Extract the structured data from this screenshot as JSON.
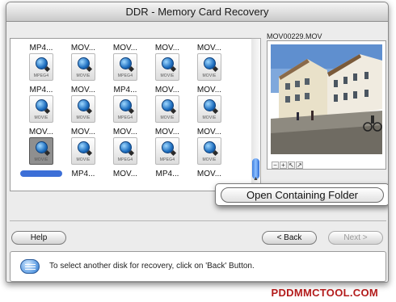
{
  "window": {
    "title": "DDR - Memory Card Recovery"
  },
  "files": [
    {
      "name": "MP4...",
      "tag": "",
      "selected": false
    },
    {
      "name": "MOV...",
      "tag": "",
      "selected": false
    },
    {
      "name": "MOV...",
      "tag": "",
      "selected": false
    },
    {
      "name": "MOV...",
      "tag": "",
      "selected": false
    },
    {
      "name": "MOV...",
      "tag": "",
      "selected": false
    },
    {
      "name": "MP4...",
      "tag": "MPEG4",
      "selected": false
    },
    {
      "name": "MOV...",
      "tag": "MOVIE",
      "selected": false
    },
    {
      "name": "MP4...",
      "tag": "MPEG4",
      "selected": false
    },
    {
      "name": "MOV...",
      "tag": "MOVIE",
      "selected": false
    },
    {
      "name": "MOV...",
      "tag": "MOVIE",
      "selected": false
    },
    {
      "name": "MOV...",
      "tag": "MOVIE",
      "selected": false
    },
    {
      "name": "MOV...",
      "tag": "MOVIE",
      "selected": false
    },
    {
      "name": "MOV...",
      "tag": "MPEG4",
      "selected": false
    },
    {
      "name": "MOV...",
      "tag": "MOVIE",
      "selected": false
    },
    {
      "name": "MOV...",
      "tag": "MOVIE",
      "selected": false
    },
    {
      "name": "MOV...",
      "tag": "MOVIE",
      "selected": true
    },
    {
      "name": "MP4...",
      "tag": "MOVIE",
      "selected": false
    },
    {
      "name": "MOV...",
      "tag": "MPEG4",
      "selected": false
    },
    {
      "name": "MP4...",
      "tag": "MPEG4",
      "selected": false
    },
    {
      "name": "MOV...",
      "tag": "MOVIE",
      "selected": false
    }
  ],
  "preview": {
    "title": "MOV00229.MOV",
    "tools": [
      "−",
      "+",
      "↖",
      "↗"
    ]
  },
  "context_menu": {
    "item": "Open Containing Folder"
  },
  "buttons": {
    "help": "Help",
    "back": "< Back",
    "next": "Next >"
  },
  "status": {
    "message": "To select another disk for recovery, click on 'Back' Button."
  },
  "brand": {
    "text": "PDDMMCTOOL.COM"
  },
  "colors": {
    "brand": "#b31b1b",
    "selection": "#3c6fd7",
    "scroll_thumb": "#3e7fe0"
  }
}
